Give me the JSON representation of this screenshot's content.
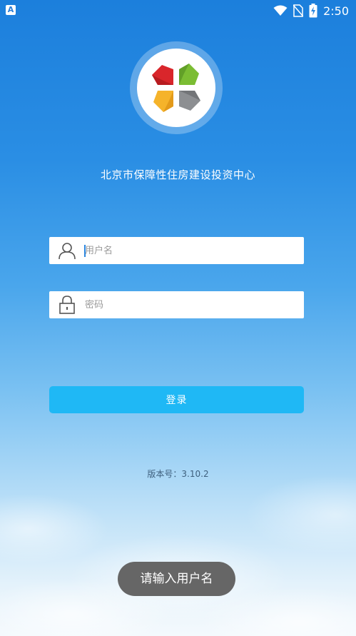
{
  "status_bar": {
    "app_icon_letter": "A",
    "time": "2:50",
    "icons": [
      "wifi-icon",
      "no-sim-icon",
      "battery-charging-icon"
    ]
  },
  "logo": {
    "icon": "colorful-diamond-logo"
  },
  "org_name": "北京市保障性住房建设投资中心",
  "form": {
    "username": {
      "placeholder": "用户名",
      "value": "",
      "icon": "user-icon"
    },
    "password": {
      "placeholder": "密码",
      "value": "",
      "icon": "lock-icon"
    },
    "login_label": "登录"
  },
  "version_label": "版本号：3.10.2",
  "toast": "请输入用户名",
  "colors": {
    "login_button": "#1fb8f5",
    "toast_bg": "#666666",
    "logo_red": "#d9262b",
    "logo_green": "#7bbd33",
    "logo_yellow": "#f5b32a",
    "logo_gray": "#8d8f92"
  }
}
